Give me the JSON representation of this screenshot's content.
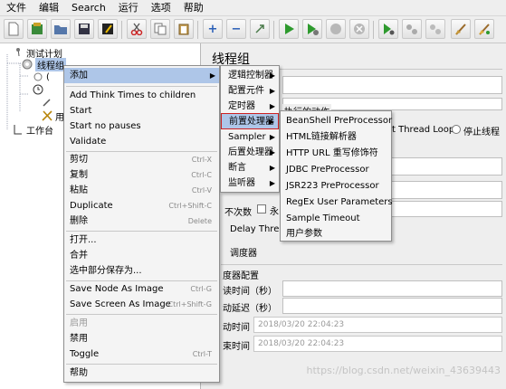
{
  "menubar": {
    "items": [
      "文件",
      "编辑",
      "Search",
      "运行",
      "选项",
      "帮助"
    ]
  },
  "tree": {
    "test_plan": "测试计划",
    "thread_group": "线程组",
    "hidden_child_1": "(",
    "hidden_child_2": "用",
    "workbench": "工作台"
  },
  "panel": {
    "title": "线程组",
    "action_partial": "执行的动作",
    "start_next_loop": "t Thread Loop",
    "stop_thread": "停止线程",
    "loop_label": "不次数",
    "forever": "永",
    "delay_thread": "Delay Threa",
    "scheduler": "调度器",
    "scheduler_config": "度器配置",
    "duration_label": "读时间（秒）",
    "startup_delay_label": "动延迟（秒）",
    "start_time_label": "动时间",
    "end_time_label": "束时间",
    "start_time_value": "2018/03/20 22:04:23",
    "end_time_value": "2018/03/20 22:04:23"
  },
  "context_menu": {
    "add": "添加",
    "add_think_times": "Add Think Times to children",
    "start": "Start",
    "start_no_pauses": "Start no pauses",
    "validate": "Validate",
    "cut": "剪切",
    "cut_acc": "Ctrl-X",
    "copy": "复制",
    "copy_acc": "Ctrl-C",
    "paste": "粘贴",
    "paste_acc": "Ctrl-V",
    "duplicate": "Duplicate",
    "duplicate_acc": "Ctrl+Shift-C",
    "delete": "删除",
    "delete_acc": "Delete",
    "open": "打开...",
    "merge": "合并",
    "save_selection": "选中部分保存为...",
    "save_node_image": "Save Node As Image",
    "save_node_image_acc": "Ctrl-G",
    "save_screen_image": "Save Screen As Image",
    "save_screen_image_acc": "Ctrl+Shift-G",
    "enable": "启用",
    "disable": "禁用",
    "toggle": "Toggle",
    "toggle_acc": "Ctrl-T",
    "help": "帮助"
  },
  "add_menu": {
    "logic_controller": "逻辑控制器",
    "config_element": "配置元件",
    "timer": "定时器",
    "pre_processors": "前置处理器",
    "sampler": "Sampler",
    "post_processors": "后置处理器",
    "assertions": "断言",
    "listener": "监听器"
  },
  "pre_menu": {
    "items": [
      "BeanShell PreProcessor",
      "HTML链接解析器",
      "HTTP URL 重写修饰符",
      "JDBC PreProcessor",
      "JSR223 PreProcessor",
      "RegEx User Parameters",
      "Sample Timeout",
      "用户参数"
    ]
  },
  "watermark": "https://blog.csdn.net/weixin_43639443",
  "colors": {
    "menu_highlight": "#aec6e8",
    "pre_highlight_border": "#cc2222",
    "run_green": "#2e9a2e"
  }
}
